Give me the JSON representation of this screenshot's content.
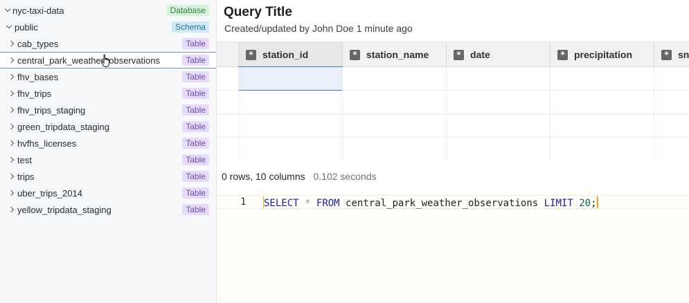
{
  "sidebar": {
    "database": {
      "label": "nyc-taxi-data",
      "badge": "Database"
    },
    "schema": {
      "label": "public",
      "badge": "Schema"
    },
    "tables": [
      {
        "label": "cab_types",
        "badge": "Table"
      },
      {
        "label": "central_park_weather_observations",
        "badge": "Table"
      },
      {
        "label": "fhv_bases",
        "badge": "Table"
      },
      {
        "label": "fhv_trips",
        "badge": "Table"
      },
      {
        "label": "fhv_trips_staging",
        "badge": "Table"
      },
      {
        "label": "green_tripdata_staging",
        "badge": "Table"
      },
      {
        "label": "hvfhs_licenses",
        "badge": "Table"
      },
      {
        "label": "test",
        "badge": "Table"
      },
      {
        "label": "trips",
        "badge": "Table"
      },
      {
        "label": "uber_trips_2014",
        "badge": "Table"
      },
      {
        "label": "yellow_tripdata_staging",
        "badge": "Table"
      }
    ],
    "hovered_index": 1
  },
  "query": {
    "title": "Query Title",
    "meta": "Created/updated by John Doe 1 minute ago"
  },
  "grid": {
    "columns": [
      "station_id",
      "station_name",
      "date",
      "precipitation",
      "sn"
    ],
    "column_icon": "*"
  },
  "status": {
    "rows_columns": "0 rows, 10 columns",
    "elapsed": "0.102 seconds"
  },
  "editor": {
    "line_number": "1",
    "tokens": {
      "select": "SELECT",
      "star": "*",
      "from": "FROM",
      "table": "central_park_weather_observations",
      "limit": "LIMIT",
      "count": "20",
      "end": ";"
    }
  },
  "colors": {
    "database_badge": "#d4f4d8",
    "schema_badge": "#cdeaf5",
    "table_badge": "#e6dcfa",
    "keyword": "#1a1aa6",
    "selection": "#4a72c4"
  }
}
